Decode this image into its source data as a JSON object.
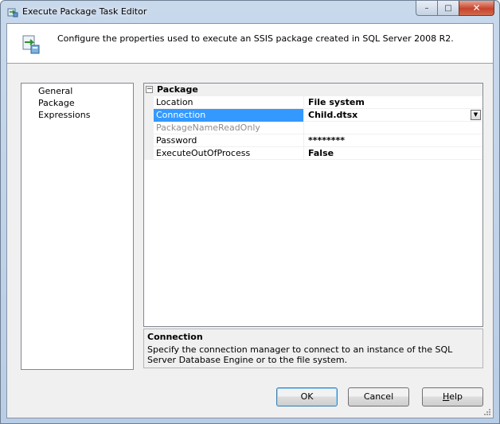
{
  "window": {
    "title": "Execute Package Task Editor",
    "caption": {
      "minimize": "–",
      "maximize": "□",
      "close": "✕"
    }
  },
  "header": {
    "icon": "package-task-icon",
    "text": "Configure the properties used to execute an SSIS package created in SQL Server 2008 R2."
  },
  "pages": [
    "General",
    "Package",
    "Expressions"
  ],
  "grid": {
    "category": {
      "toggle": "−",
      "label": "Package"
    },
    "properties": [
      {
        "name": "Location",
        "value": "File system"
      },
      {
        "name": "Connection",
        "value": "Child.dtsx"
      },
      {
        "name": "PackageNameReadOnly",
        "value": ""
      },
      {
        "name": "Password",
        "value": "********"
      },
      {
        "name": "ExecuteOutOfProcess",
        "value": "False"
      }
    ],
    "dropdown_glyph": "▼"
  },
  "description": {
    "title": "Connection",
    "text": "Specify the connection manager to connect to an instance of the SQL Server Database Engine or to the file system."
  },
  "buttons": {
    "ok": "OK",
    "cancel": "Cancel",
    "help_first": "H",
    "help_rest": "elp"
  },
  "colors": {
    "selection": "#3399ff",
    "face": "#f0f0f0"
  }
}
